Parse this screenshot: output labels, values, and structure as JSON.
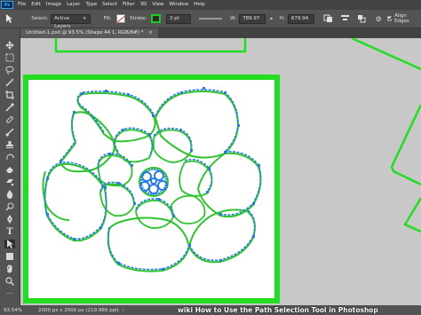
{
  "menu": {
    "logo": "Ps",
    "items": [
      "File",
      "Edit",
      "Image",
      "Layer",
      "Type",
      "Select",
      "Filter",
      "3D",
      "View",
      "Window",
      "Help"
    ]
  },
  "options": {
    "select_label": "Select:",
    "select_value": "Active Layers",
    "fill_label": "Fill:",
    "stroke_label": "Stroke:",
    "stroke_width": "2 pt",
    "w_label": "W:",
    "w_value": "789.97",
    "h_label": "H:",
    "h_value": "679.94",
    "align_edges": "Align Edges",
    "stroke_color": "#22cc22"
  },
  "document": {
    "tab_title": "Untitled-1.psd @ 93.5% (Shape 44 1, RGB/8#) *",
    "close_glyph": "×"
  },
  "status": {
    "zoom": "93.54%",
    "doc_size": "2000 px x 2000 px (219.989 ppi)"
  },
  "watermark": {
    "brand": "wiki",
    "title": "How to Use the Path Selection Tool in Photoshop"
  },
  "colors": {
    "frame_green": "#22dd22",
    "path_blue": "#2a7de0",
    "shape_green": "#2fc22f",
    "bg_canvas": "#c8c8c8"
  },
  "icons": [
    "move-icon",
    "marquee-icon",
    "lasso-icon",
    "magic-wand-icon",
    "crop-icon",
    "eyedropper-icon",
    "healing-icon",
    "brush-icon",
    "stamp-icon",
    "history-brush-icon",
    "eraser-icon",
    "gradient-icon",
    "blur-icon",
    "dodge-icon",
    "pen-icon",
    "type-icon",
    "path-selection-icon",
    "shape-icon",
    "hand-icon",
    "zoom-icon"
  ]
}
